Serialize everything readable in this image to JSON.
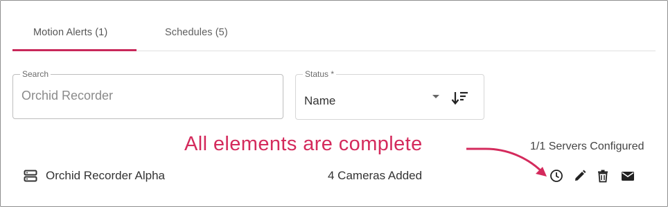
{
  "tabs": [
    {
      "label": "Motion Alerts (1)"
    },
    {
      "label": "Schedules (5)"
    }
  ],
  "search": {
    "label": "Search",
    "placeholder": "Orchid Recorder"
  },
  "status": {
    "label": "Status *",
    "value": "Name"
  },
  "annotation": {
    "text": "All elements are complete"
  },
  "summary": {
    "servers_configured": "1/1 Servers Configured"
  },
  "rows": [
    {
      "name": "Orchid Recorder Alpha",
      "cameras": "4 Cameras Added"
    }
  ],
  "colors": {
    "accent": "#c8285a",
    "annotation": "#d42a5c"
  },
  "icons": [
    "server-icon",
    "sort-icon",
    "clock-icon",
    "edit-icon",
    "trash-icon",
    "mail-icon",
    "chevron-down-icon"
  ]
}
